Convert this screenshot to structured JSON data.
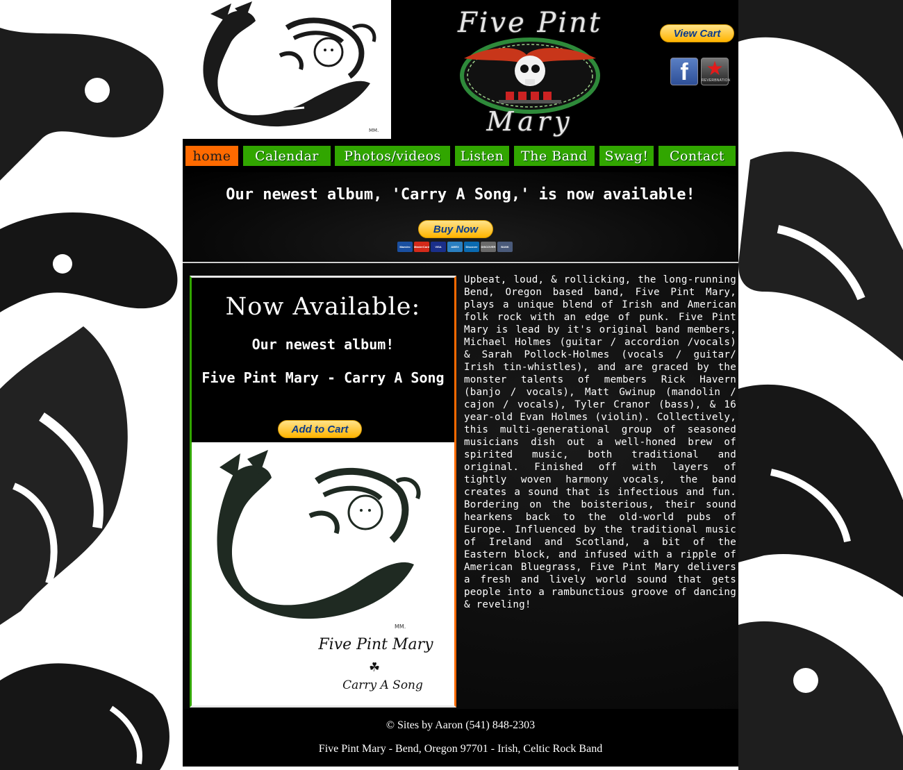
{
  "colors": {
    "nav_green": "#31a600",
    "nav_active": "#ff6a00",
    "paypal_gold": "#ffb400",
    "paypal_text": "#0b3b8a",
    "page_bg": "#000000"
  },
  "header": {
    "logo_line1": "Five Pint",
    "logo_line2": "Mary",
    "view_cart_label": "View Cart",
    "social": {
      "facebook_glyph": "f",
      "reverbnation_label": "REVERBNATION"
    }
  },
  "nav": {
    "items": [
      {
        "label": "home",
        "active": true
      },
      {
        "label": "Calendar",
        "active": false
      },
      {
        "label": "Photos/videos",
        "active": false
      },
      {
        "label": "Listen",
        "active": false
      },
      {
        "label": "The Band",
        "active": false
      },
      {
        "label": "Swag!",
        "active": false
      },
      {
        "label": "Contact",
        "active": false
      }
    ]
  },
  "promo": {
    "text": "Our newest album, 'Carry A Song,' is now available!",
    "buy_now_label": "Buy Now",
    "payment_cards": [
      {
        "name": "Maestro",
        "color": "#1a4fa0"
      },
      {
        "name": "MasterCard",
        "color": "#d42a1a"
      },
      {
        "name": "VISA",
        "color": "#1a2f8a"
      },
      {
        "name": "AMEX",
        "color": "#2a7fc0"
      },
      {
        "name": "Discover",
        "color": "#0a6ab0"
      },
      {
        "name": "DISCOVER",
        "color": "#6a6a6a"
      },
      {
        "name": "BANK",
        "color": "#4a5a7a"
      }
    ]
  },
  "album": {
    "heading": "Now Available:",
    "subheading": "Our newest album!",
    "title": "Five Pint Mary - Carry A Song",
    "add_to_cart_label": "Add to Cart",
    "cover_title": "Five Pint Mary",
    "cover_subtitle": "Carry A Song"
  },
  "bio": {
    "text": "Upbeat, loud, & rollicking, the long-running Bend, Oregon based band, Five Pint Mary, plays a unique blend of Irish and American folk rock with an edge of punk. Five Pint Mary is lead by it's original band members, Michael Holmes (guitar / accordion /vocals) & Sarah Pollock-Holmes (vocals / guitar/ Irish tin-whistles), and are graced by the monster talents of members Rick Havern (banjo / vocals), Matt Gwinup (mandolin / cajon / vocals), Tyler Cranor (bass), & 16 year-old Evan Holmes (violin). Collectively, this multi-generational group of seasoned musicians dish out a well-honed brew of spirited music, both traditional and original. Finished off with layers of tightly woven harmony vocals, the band creates a sound that is infectious and fun. Bordering on the boisterious, their sound hearkens back to the old-world pubs of Europe. Influenced by the traditional music of Ireland and Scotland, a bit of the Eastern block, and infused with a ripple of American Bluegrass, Five Pint Mary delivers a fresh and lively world sound that gets people into a rambunctious groove of dancing & reveling!"
  },
  "footer": {
    "credit": "© Sites by Aaron (541) 848-2303",
    "address": "Five Pint Mary - Bend, Oregon 97701 - Irish, Celtic Rock Band"
  }
}
